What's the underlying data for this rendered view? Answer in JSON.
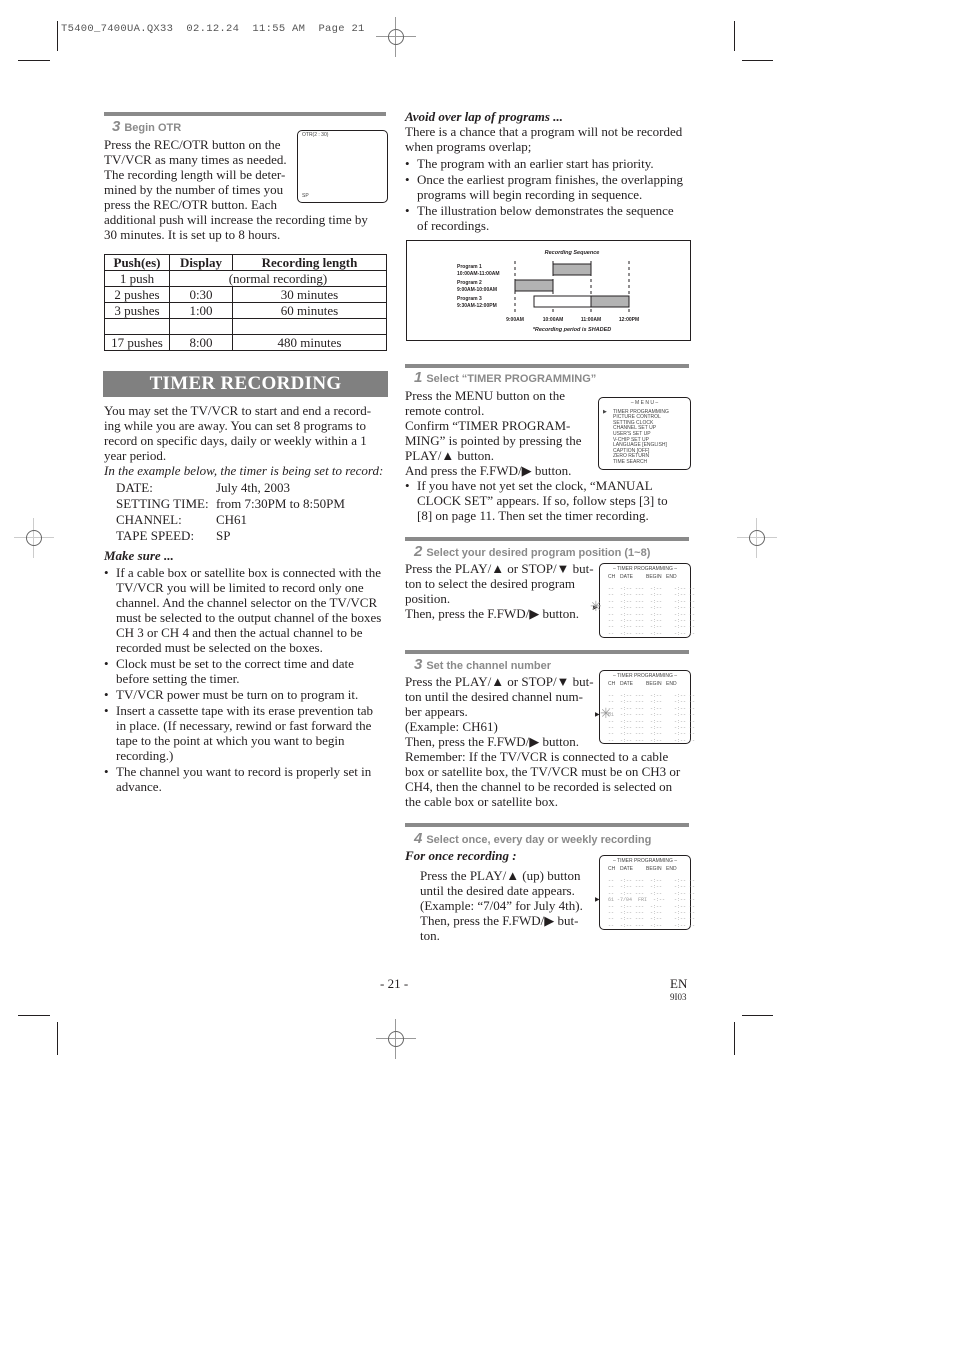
{
  "slug": "T5400_7400UA.QX33  02.12.24  11:55 AM  Page 21",
  "otr": {
    "step_num": "3",
    "step_title": "Begin OTR",
    "para_1": "Press the REC/OTR button on the TV/VCR as many times as needed. The recording length will be determined by the number of times you press the REC/OTR button. Each additional push will increase the recording time by 30 minutes. It is set up to 8 hours.",
    "lines": [
      "Press the REC/OTR button on the",
      "TV/VCR as many times as needed.",
      "The recording length will be deter-",
      "mined by the number of times you",
      "press the REC/OTR button. Each",
      "additional push will increase the recording time by",
      "30 minutes. It is set up to 8 hours."
    ],
    "screen_top": "OTR(2 : 30)",
    "screen_bottom": "SP",
    "table": {
      "headers": [
        "Push(es)",
        "Display",
        "Recording length"
      ],
      "rows": [
        [
          "1 push",
          "(normal recording)",
          ""
        ],
        [
          "2 pushes",
          "0:30",
          "30 minutes"
        ],
        [
          "3 pushes",
          "1:00",
          "60 minutes"
        ],
        [
          "",
          "",
          ""
        ],
        [
          "17 pushes",
          "8:00",
          "480 minutes"
        ]
      ]
    }
  },
  "timer": {
    "title": "TIMER RECORDING",
    "intro": [
      "You may set the TV/VCR to start and end a record-",
      "ing while you are away. You can set 8 programs to",
      "record on specific days, daily or weekly within a 1",
      "year period."
    ],
    "example_intro": "In the example below, the timer is being set to record:",
    "example": [
      {
        "label": "DATE:",
        "value": "July 4th, 2003"
      },
      {
        "label": "SETTING TIME:",
        "value": "from 7:30PM to 8:50PM"
      },
      {
        "label": "CHANNEL:",
        "value": "CH61"
      },
      {
        "label": "TAPE SPEED:",
        "value": "SP"
      }
    ],
    "make_sure_heading": "Make sure ...",
    "make_sure": [
      [
        "If a cable box or satellite box is connected with the",
        "TV/VCR you will be limited to record only one",
        "channel.  And the channel selector on the TV/VCR",
        "must be selected to the output channel of the boxes",
        "CH 3 or CH 4 and then the actual channel to be",
        "recorded must be selected on the boxes."
      ],
      [
        "Clock must be set to the correct time and date",
        "before setting the timer."
      ],
      [
        "TV/VCR power must be turn on to program it."
      ],
      [
        "Insert a cassette tape with its erase prevention tab",
        "in place. (If necessary, rewind or fast forward the",
        "tape to the point at which you want to begin",
        "recording.)"
      ],
      [
        "The channel you want to record is properly set in",
        "advance."
      ]
    ]
  },
  "overlap": {
    "heading": "Avoid over lap of programs ...",
    "intro": [
      "There is a chance that a program will not be recorded",
      "when programs overlap;"
    ],
    "bullets": [
      [
        "The program with an earlier start has priority."
      ],
      [
        "Once the earliest program finishes, the overlapping",
        "programs will begin recording in sequence."
      ],
      [
        "The illustration below demonstrates the sequence",
        "of recordings."
      ]
    ],
    "diagram": {
      "title": "Recording Sequence",
      "footnote": "*Recording period is SHADED",
      "time_ticks": [
        "9:00AM",
        "10:00AM",
        "11:00AM",
        "12:00PM"
      ],
      "programs": [
        {
          "name": "Program 1",
          "time": "10:00AM-11:00AM",
          "start_h": 10.0,
          "end_h": 11.0,
          "recorded_from_h": 10.0
        },
        {
          "name": "Program 2",
          "time": "9:00AM-10:00AM",
          "start_h": 9.0,
          "end_h": 10.0,
          "recorded_from_h": 9.0
        },
        {
          "name": "Program 3",
          "time": "9:30AM-12:00PM",
          "start_h": 9.5,
          "end_h": 12.0,
          "recorded_from_h": 11.0
        }
      ]
    }
  },
  "steps": [
    {
      "num": "1",
      "title": "Select “TIMER PROGRAMMING”",
      "lines": [
        "Press the MENU button on the",
        "remote control.",
        "Confirm “TIMER PROGRAM-",
        "MING” is pointed by pressing the",
        "PLAY/▲ button.",
        "And press the F.FWD/▶ button."
      ],
      "bullet": [
        "If you have not yet set the clock, “MANUAL",
        "CLOCK SET” appears. If so, follow steps [3] to",
        "[8] on page 11. Then set the timer recording."
      ],
      "menu": {
        "title": "– M E N U –",
        "items": [
          "TIMER PROGRAMMING",
          "PICTURE CONTROL",
          "SETTING CLOCK",
          "CHANNEL SET UP",
          "USER'S SET UP",
          "V-CHIP SET UP",
          "LANGUAGE  [ENGLISH]",
          "CAPTION  [OFF]",
          "ZERO RETURN",
          "TIME SEARCH"
        ],
        "selected_index": 0
      }
    },
    {
      "num": "2",
      "title": "Select your desired program position (1~8)",
      "lines": [
        "Press the PLAY/▲ or STOP/▼ but-",
        "ton to select the desired program",
        "position.",
        "Then, press the F.FWD/▶ button."
      ]
    },
    {
      "num": "3",
      "title": "Set the channel number",
      "lines": [
        "Press the PLAY/▲ or STOP/▼ but-",
        "ton until the desired channel num-",
        "ber appears.",
        "(Example: CH61)",
        "Then, press the F.FWD/▶ button."
      ],
      "remember": [
        "Remember: If the TV/VCR is connected to a cable",
        "box or satellite box, the TV/VCR must be on CH3 or",
        "CH4, then the channel to be recorded is selected on",
        "the cable box or satellite box."
      ]
    },
    {
      "num": "4",
      "title": "Select once, every day or weekly recording",
      "subheading": "For once recording :",
      "lines": [
        "Press the PLAY/▲ (up) button",
        "until the desired date appears.",
        "(Example: “7/04” for July 4th).",
        "Then, press the F.FWD/▶ but-",
        "ton."
      ]
    }
  ],
  "tp_screen": {
    "title": "– TIMER PROGRAMMING –",
    "headers": [
      "CH",
      "DATE",
      "BEGIN",
      "END"
    ],
    "blank_row": "--  -:-- ---  -:--    -:-- --",
    "row_step3": "61  -:-- ---  -:--    -:-- --",
    "row_step4": "61 -7/04  FRI  -:--   -:-- --"
  },
  "footer": {
    "page": "- 21 -",
    "lang": "EN",
    "code": "9I03"
  }
}
